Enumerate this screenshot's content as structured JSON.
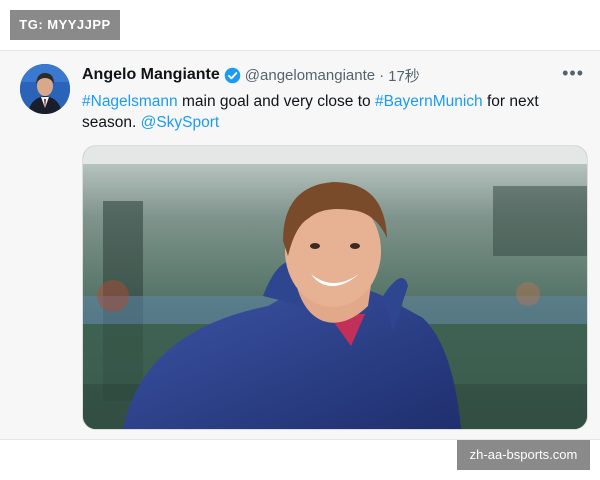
{
  "top_badge": {
    "label": "TG: MYYJJPP"
  },
  "tweet": {
    "author": {
      "display_name": "Angelo Mangiante",
      "handle": "@angelomangiante",
      "verified": true,
      "avatar_icon": "avatar-photo-icon"
    },
    "separator": "·",
    "time": "17秒",
    "more_icon": "more-options-icon",
    "text_parts": {
      "hashtag_1": "#Nagelsmann",
      "text_1": " main goal and very close to ",
      "hashtag_2": "#BayernMunich",
      "text_2": " for next season. ",
      "mention": "@SkySport"
    },
    "media": {
      "icon": "photo-icon"
    }
  },
  "watermark": {
    "label": "zh-aa-bsports.com"
  },
  "colors": {
    "link": "#1d9bf0",
    "verified": "#1d9bf0",
    "badge_bg": "#8a8a8a",
    "jacket": "#2b3f86"
  }
}
